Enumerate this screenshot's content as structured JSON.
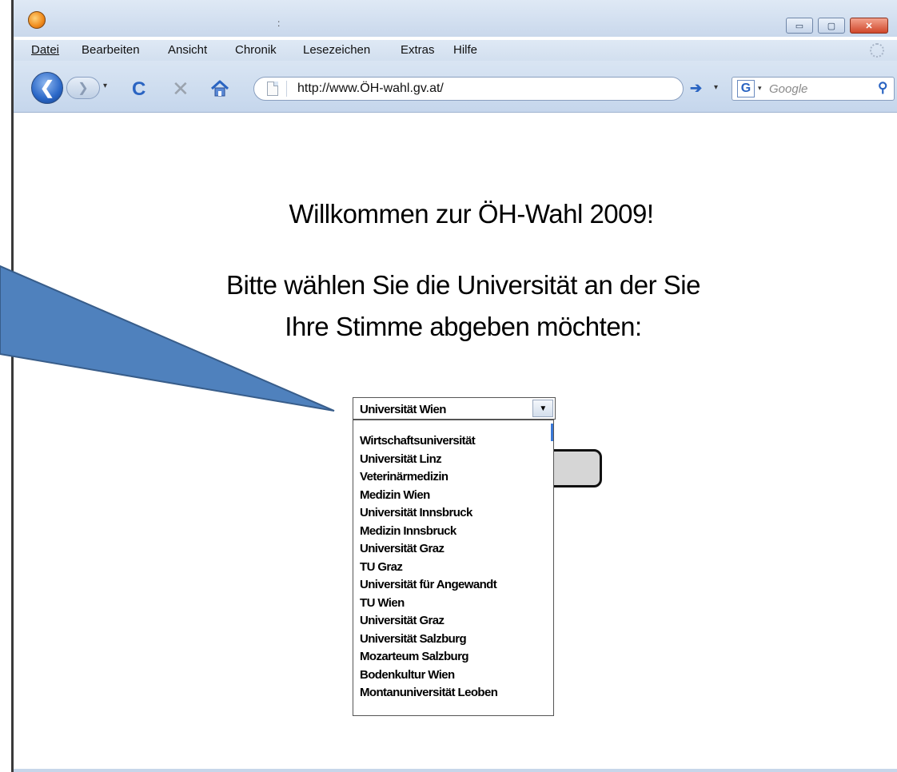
{
  "window": {
    "title": ":",
    "buttons": {
      "minimize": "▭",
      "maximize": "▢",
      "close": "✕"
    }
  },
  "menubar": {
    "items": [
      {
        "label": "Datei"
      },
      {
        "label": "Bearbeiten"
      },
      {
        "label": "Ansicht"
      },
      {
        "label": "Chronik"
      },
      {
        "label": "Lesezeichen"
      },
      {
        "label": "Extras"
      },
      {
        "label": "Hilfe"
      }
    ]
  },
  "navbar": {
    "back_glyph": "❮",
    "forward_glyph": "❯",
    "reload_glyph": "C",
    "stop_glyph": "✕",
    "url": "http://www.ÖH-wahl.gv.at/",
    "go_glyph": "➔",
    "dropdown_glyph": "▾",
    "search_engine_letter": "G",
    "search_placeholder": "Google",
    "search_glyph": "⚲"
  },
  "page": {
    "title": "Willkommen zur ÖH-Wahl 2009!",
    "instruction_line1": "Bitte wählen Sie die Universität an der Sie",
    "instruction_line2": "Ihre Stimme abgeben möchten:"
  },
  "university_select": {
    "selected": "Universität Wien",
    "arrow_glyph": "▼",
    "options": [
      "Wirtschaftsuniversität",
      "Universität Linz",
      "Veterinärmedizin",
      "Medizin Wien",
      "Universität Innsbruck",
      "Medizin Innsbruck",
      "Universität Graz",
      "TU Graz",
      "Universität für Angewandt",
      "TU Wien",
      "Universität Graz",
      "Universität Salzburg",
      "Mozarteum Salzburg",
      "Bodenkultur Wien",
      "Montanuniversität Leoben"
    ]
  },
  "colors": {
    "chrome_top": "#dfe9f5",
    "chrome_bottom": "#c5d6ec",
    "accent_blue": "#2a64c2",
    "callout_fill": "#4f81bd",
    "callout_stroke": "#385d8a"
  }
}
